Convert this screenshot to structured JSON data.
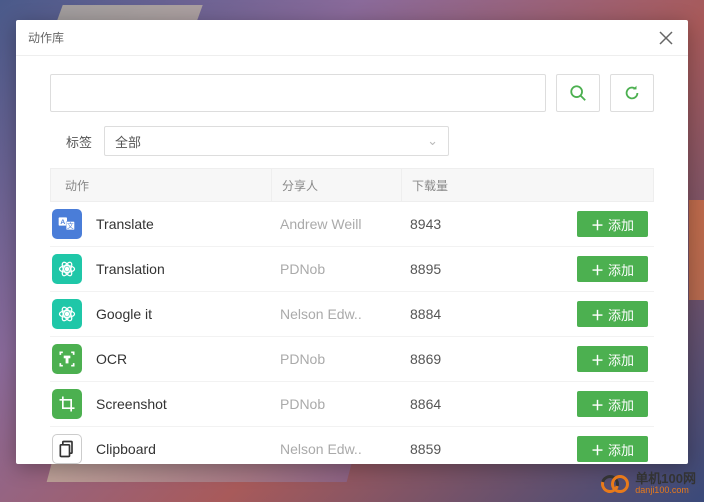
{
  "window": {
    "title": "动作库"
  },
  "search": {
    "placeholder": ""
  },
  "tags": {
    "label": "标签",
    "selected": "全部"
  },
  "table": {
    "headers": {
      "action": "动作",
      "sharer": "分享人",
      "downloads": "下载量"
    },
    "addLabel": "添加",
    "rows": [
      {
        "name": "Translate",
        "sharer": "Andrew Weill",
        "downloads": "8943",
        "iconBg": "#4a7dd8",
        "iconType": "translate"
      },
      {
        "name": "Translation",
        "sharer": "PDNob",
        "downloads": "8895",
        "iconBg": "#1fc7a8",
        "iconType": "atom"
      },
      {
        "name": "Google it",
        "sharer": "Nelson Edw..",
        "downloads": "8884",
        "iconBg": "#1fc7a8",
        "iconType": "atom"
      },
      {
        "name": "OCR",
        "sharer": "PDNob",
        "downloads": "8869",
        "iconBg": "#4cb050",
        "iconType": "ocr"
      },
      {
        "name": "Screenshot",
        "sharer": "PDNob",
        "downloads": "8864",
        "iconBg": "#4cb050",
        "iconType": "crop"
      },
      {
        "name": "Clipboard",
        "sharer": "Nelson Edw..",
        "downloads": "8859",
        "iconBg": "#ffffff",
        "iconType": "clipboard"
      }
    ]
  },
  "watermark": {
    "cn": "单机100网",
    "en": "danji100.com"
  }
}
